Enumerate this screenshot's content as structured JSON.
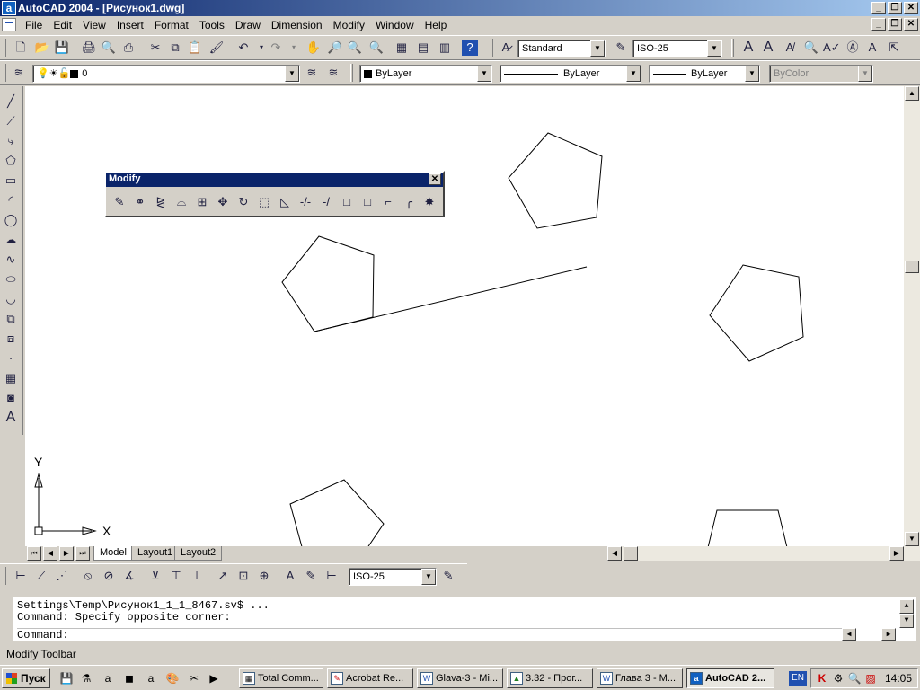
{
  "window": {
    "title": "AutoCAD 2004 - [Рисунок1.dwg]",
    "min": "_",
    "restore": "❐",
    "close": "✕"
  },
  "menu": [
    "File",
    "Edit",
    "View",
    "Insert",
    "Format",
    "Tools",
    "Draw",
    "Dimension",
    "Modify",
    "Window",
    "Help"
  ],
  "styles": {
    "text_style": "Standard",
    "dim_style": "ISO-25"
  },
  "properties": {
    "layer": "0",
    "color": "ByLayer",
    "linetype": "ByLayer",
    "lineweight": "ByLayer",
    "plotstyle": "ByColor"
  },
  "modify_toolbar": {
    "title": "Modify",
    "close": "✕"
  },
  "layout_tabs": [
    "Model",
    "Layout1",
    "Layout2"
  ],
  "ucs": {
    "x_label": "X",
    "y_label": "Y"
  },
  "dim_toolbar": {
    "dim_style": "ISO-25"
  },
  "command_lines": [
    "Settings\\Temp\\Рисунок1_1_1_8467.sv$ ...",
    "Command: Specify opposite corner:",
    "Command:"
  ],
  "status_text": "Modify Toolbar",
  "taskbar": {
    "start": "Пуск",
    "tasks": [
      "Total Comm...",
      "Acrobat Re...",
      "Glava-3 - Mi...",
      "3.32 - Прог...",
      "Глава 3 - M...",
      "AutoCAD 2..."
    ],
    "lang": "EN",
    "clock": "14:05"
  }
}
